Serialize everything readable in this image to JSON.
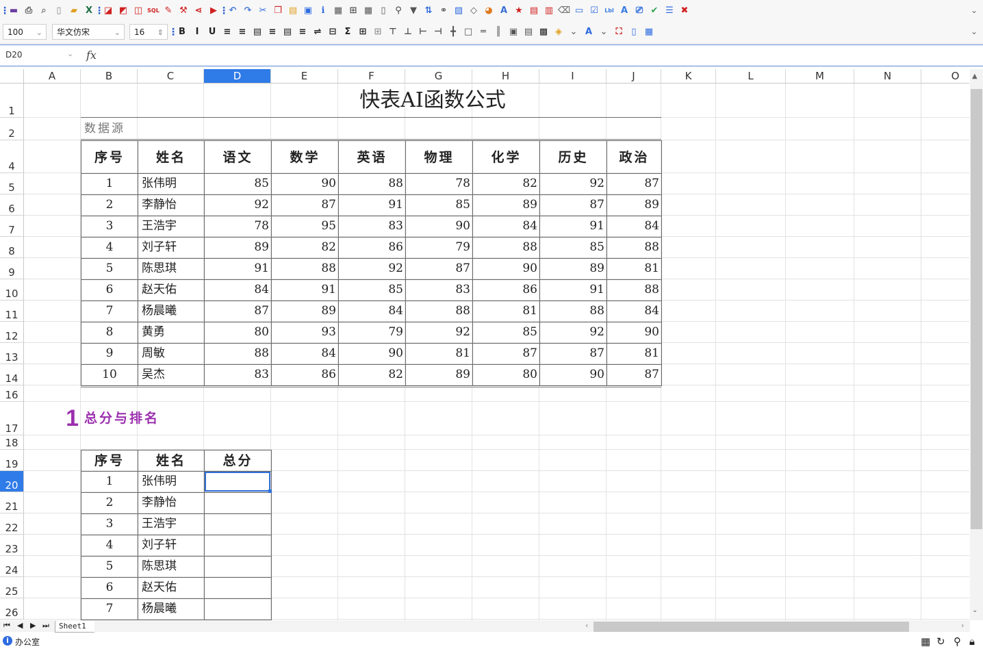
{
  "toolbar1": {
    "icons": [
      {
        "name": "more-vert-icon",
        "glyph": "⋮",
        "color": "#2e5fd6"
      },
      {
        "name": "save-icon",
        "glyph": "▬",
        "color": "#6b3fa0"
      },
      {
        "name": "print-icon",
        "glyph": "⎙",
        "color": "#555555"
      },
      {
        "name": "print-preview-icon",
        "glyph": "⌕",
        "color": "#777777"
      },
      {
        "name": "page-setup-icon",
        "glyph": "▯",
        "color": "#888888"
      },
      {
        "name": "open-folder-icon",
        "glyph": "▰",
        "color": "#e0a020"
      },
      {
        "name": "export-excel-icon",
        "glyph": "X",
        "color": "#1e7145"
      },
      {
        "name": "more-vert-icon",
        "glyph": "⋮",
        "color": "#2e5fd6"
      },
      {
        "name": "export-pdf-icon",
        "glyph": "◪",
        "color": "#d02020"
      },
      {
        "name": "export-image-icon",
        "glyph": "◩",
        "color": "#d02020"
      },
      {
        "name": "export-data-icon",
        "glyph": "◫",
        "color": "#d02020"
      },
      {
        "name": "sql-icon",
        "glyph": "SQL",
        "color": "#d02020"
      },
      {
        "name": "brush-icon",
        "glyph": "✎",
        "color": "#d02020"
      },
      {
        "name": "tools-icon",
        "glyph": "⚒",
        "color": "#d02020"
      },
      {
        "name": "share-icon",
        "glyph": "⋖",
        "color": "#d02020"
      },
      {
        "name": "run-icon",
        "glyph": "▶",
        "color": "#d02020"
      },
      {
        "name": "more-vert-icon",
        "glyph": "⋮",
        "color": "#2e5fd6"
      },
      {
        "name": "undo-icon",
        "glyph": "↶",
        "color": "#4a7bd8"
      },
      {
        "name": "redo-icon",
        "glyph": "↷",
        "color": "#4a7bd8"
      },
      {
        "name": "cut-icon",
        "glyph": "✂",
        "color": "#2e6be0"
      },
      {
        "name": "copy-icon",
        "glyph": "❐",
        "color": "#d02020"
      },
      {
        "name": "paste-icon",
        "glyph": "▤",
        "color": "#e0a020"
      },
      {
        "name": "format-painter-icon",
        "glyph": "▣",
        "color": "#2e6be0"
      },
      {
        "name": "info-icon",
        "glyph": "ℹ",
        "color": "#2e6be0"
      },
      {
        "name": "table-icon",
        "glyph": "▦",
        "color": "#555555"
      },
      {
        "name": "freeze-icon",
        "glyph": "⊞",
        "color": "#555555"
      },
      {
        "name": "grid-icon",
        "glyph": "▦",
        "color": "#555555"
      },
      {
        "name": "paper-icon",
        "glyph": "▯",
        "color": "#555555"
      },
      {
        "name": "find-icon",
        "glyph": "⚲",
        "color": "#444444"
      },
      {
        "name": "filter-icon",
        "glyph": "▼",
        "color": "#555555"
      },
      {
        "name": "sort-icon",
        "glyph": "⇅",
        "color": "#2e6be0"
      },
      {
        "name": "link-icon",
        "glyph": "⚭",
        "color": "#555555"
      },
      {
        "name": "insert-image-icon",
        "glyph": "▨",
        "color": "#2e6be0"
      },
      {
        "name": "shape-icon",
        "glyph": "◇",
        "color": "#555555"
      },
      {
        "name": "chart-icon",
        "glyph": "◕",
        "color": "#e07a20"
      },
      {
        "name": "text-style-icon",
        "glyph": "A",
        "color": "#3a6fd6"
      },
      {
        "name": "star-icon",
        "glyph": "★",
        "color": "#d02020"
      },
      {
        "name": "form-edit-icon",
        "glyph": "▤",
        "color": "#d02020"
      },
      {
        "name": "barcode-icon",
        "glyph": "▥",
        "color": "#d02020"
      },
      {
        "name": "eraser-icon",
        "glyph": "⌫",
        "color": "#777777"
      },
      {
        "name": "comment-icon",
        "glyph": "▭",
        "color": "#2e6be0"
      },
      {
        "name": "checkbox-icon",
        "glyph": "☑",
        "color": "#2e6be0"
      },
      {
        "name": "label-icon",
        "glyph": "Lbl",
        "color": "#3a7be0"
      },
      {
        "name": "textbox-icon",
        "glyph": "A",
        "color": "#3a7be0"
      },
      {
        "name": "screen-icon",
        "glyph": "⎚",
        "color": "#2e6be0"
      },
      {
        "name": "confirm-icon",
        "glyph": "✔",
        "color": "#2ea44f"
      },
      {
        "name": "list-icon",
        "glyph": "☰",
        "color": "#2e6be0"
      },
      {
        "name": "close-icon",
        "glyph": "✖",
        "color": "#d02020"
      }
    ]
  },
  "toolbar2": {
    "zoom": "100",
    "font_family": "华文仿宋",
    "font_size": "16",
    "icons": [
      {
        "name": "more-vert-icon",
        "glyph": "⋮",
        "color": "#2e5fd6"
      },
      {
        "name": "bold-icon",
        "glyph": "B",
        "color": "#222222"
      },
      {
        "name": "italic-icon",
        "glyph": "I",
        "color": "#222222"
      },
      {
        "name": "underline-icon",
        "glyph": "U",
        "color": "#222222"
      },
      {
        "name": "align-left-icon",
        "glyph": "≡",
        "color": "#222222"
      },
      {
        "name": "align-center-icon",
        "glyph": "≡",
        "color": "#222222"
      },
      {
        "name": "align-right-icon",
        "glyph": "▤",
        "color": "#222222"
      },
      {
        "name": "align-top-icon",
        "glyph": "≡",
        "color": "#222222"
      },
      {
        "name": "align-justify-icon",
        "glyph": "▤",
        "color": "#222222"
      },
      {
        "name": "align-bottom-icon",
        "glyph": "≡",
        "color": "#222222"
      },
      {
        "name": "wrap-text-icon",
        "glyph": "⇌",
        "color": "#222222"
      },
      {
        "name": "merge-cells-icon",
        "glyph": "⊟",
        "color": "#222222"
      },
      {
        "name": "sum-icon",
        "glyph": "Σ",
        "color": "#222222"
      },
      {
        "name": "border-all-icon",
        "glyph": "⊞",
        "color": "#222222"
      },
      {
        "name": "border-none-icon",
        "glyph": "⊞",
        "color": "#999999"
      },
      {
        "name": "border-top-icon",
        "glyph": "⊤",
        "color": "#555555"
      },
      {
        "name": "border-bottom-icon",
        "glyph": "⊥",
        "color": "#555555"
      },
      {
        "name": "border-left-icon",
        "glyph": "⊢",
        "color": "#555555"
      },
      {
        "name": "border-right-icon",
        "glyph": "⊣",
        "color": "#555555"
      },
      {
        "name": "border-inner-icon",
        "glyph": "╋",
        "color": "#555555"
      },
      {
        "name": "border-outer-icon",
        "glyph": "□",
        "color": "#555555"
      },
      {
        "name": "border-horizontal-icon",
        "glyph": "═",
        "color": "#555555"
      },
      {
        "name": "border-vertical-icon",
        "glyph": "║",
        "color": "#555555"
      },
      {
        "name": "border-thick-icon",
        "glyph": "▣",
        "color": "#555555"
      },
      {
        "name": "border-double-icon",
        "glyph": "▤",
        "color": "#555555"
      },
      {
        "name": "border-box-icon",
        "glyph": "▩",
        "color": "#222222"
      },
      {
        "name": "fill-color-icon",
        "glyph": "◈",
        "color": "#e0a020"
      },
      {
        "name": "chevron-down-icon",
        "glyph": "⌄",
        "color": "#777777"
      },
      {
        "name": "font-color-icon",
        "glyph": "A",
        "color": "#2e6be0"
      },
      {
        "name": "chevron-down-icon",
        "glyph": "⌄",
        "color": "#777777"
      },
      {
        "name": "select-range-icon",
        "glyph": "⛶",
        "color": "#d02020"
      },
      {
        "name": "mobile-icon",
        "glyph": "▯",
        "color": "#2e6be0"
      },
      {
        "name": "qrcode-icon",
        "glyph": "▦",
        "color": "#2e6be0"
      }
    ]
  },
  "formula_bar": {
    "cell_ref": "D20",
    "fx_label": "fx",
    "formula": ""
  },
  "grid": {
    "columns": [
      "A",
      "B",
      "C",
      "D",
      "E",
      "F",
      "G",
      "H",
      "I",
      "J",
      "K",
      "L",
      "M",
      "N",
      "O"
    ],
    "selected_column": "D",
    "rows": [
      "1",
      "2",
      "4",
      "5",
      "6",
      "7",
      "8",
      "9",
      "10",
      "11",
      "12",
      "13",
      "14",
      "16",
      "17",
      "18",
      "19",
      "20",
      "21",
      "22",
      "23",
      "24",
      "25",
      "26"
    ],
    "selected_row": "20"
  },
  "sheet": {
    "title": "快表AI函数公式",
    "section_label": "数据源",
    "headers": [
      "序号",
      "姓名",
      "语文",
      "数学",
      "英语",
      "物理",
      "化学",
      "历史",
      "政治"
    ],
    "students": [
      [
        "1",
        "张伟明",
        "85",
        "90",
        "88",
        "78",
        "82",
        "92",
        "87"
      ],
      [
        "2",
        "李静怡",
        "92",
        "87",
        "91",
        "85",
        "89",
        "87",
        "89"
      ],
      [
        "3",
        "王浩宇",
        "78",
        "95",
        "83",
        "90",
        "84",
        "91",
        "84"
      ],
      [
        "4",
        "刘子轩",
        "89",
        "82",
        "86",
        "79",
        "88",
        "85",
        "88"
      ],
      [
        "5",
        "陈思琪",
        "91",
        "88",
        "92",
        "87",
        "90",
        "89",
        "81"
      ],
      [
        "6",
        "赵天佑",
        "84",
        "91",
        "85",
        "83",
        "86",
        "91",
        "88"
      ],
      [
        "7",
        "杨晨曦",
        "87",
        "89",
        "84",
        "88",
        "81",
        "88",
        "84"
      ],
      [
        "8",
        "黄勇",
        "80",
        "93",
        "79",
        "92",
        "85",
        "92",
        "90"
      ],
      [
        "9",
        "周敏",
        "88",
        "84",
        "90",
        "81",
        "87",
        "87",
        "81"
      ],
      [
        "10",
        "吴杰",
        "83",
        "86",
        "82",
        "89",
        "80",
        "90",
        "87"
      ]
    ],
    "task_number": "1",
    "task_title": "总分与排名",
    "task_headers": [
      "序号",
      "姓名",
      "总分"
    ],
    "task_rows": [
      [
        "1",
        "张伟明"
      ],
      [
        "2",
        "李静怡"
      ],
      [
        "3",
        "王浩宇"
      ],
      [
        "4",
        "刘子轩"
      ],
      [
        "5",
        "陈思琪"
      ],
      [
        "6",
        "赵天佑"
      ],
      [
        "7",
        "杨晨曦"
      ]
    ],
    "accent_color": "#9b2fae"
  },
  "tabs": {
    "sheets": [
      "Sheet1"
    ],
    "active": "Sheet1"
  },
  "status": {
    "text": "办公室",
    "info_glyph": "i"
  }
}
